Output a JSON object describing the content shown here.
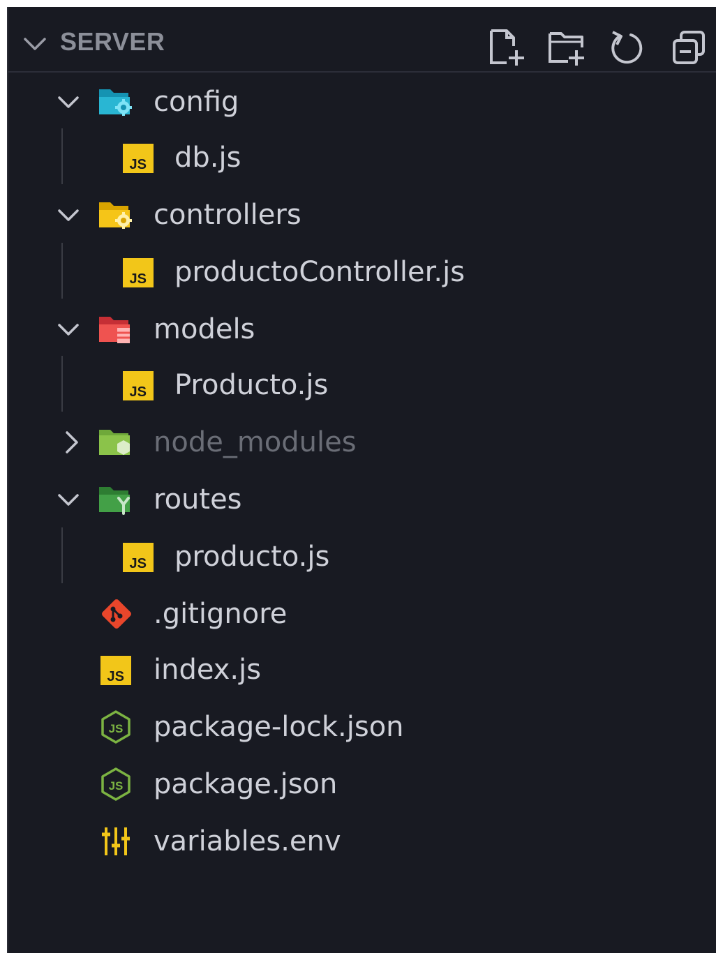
{
  "header": {
    "title": "SERVER",
    "icons": [
      "new-file-icon",
      "new-folder-icon",
      "refresh-icon",
      "collapse-all-icon"
    ]
  },
  "tree": [
    {
      "name": "config",
      "type": "folder",
      "expanded": true,
      "depth": 0,
      "icon": "folder-config-icon",
      "color": "#1fa6c3"
    },
    {
      "name": "db.js",
      "type": "file",
      "depth": 1,
      "icon": "js-file-icon",
      "color": "#f2c619"
    },
    {
      "name": "controllers",
      "type": "folder",
      "expanded": true,
      "depth": 0,
      "icon": "folder-controllers-icon",
      "color": "#f2c619"
    },
    {
      "name": "productoController.js",
      "type": "file",
      "depth": 1,
      "icon": "js-file-icon",
      "color": "#f2c619"
    },
    {
      "name": "models",
      "type": "folder",
      "expanded": true,
      "depth": 0,
      "icon": "folder-models-icon",
      "color": "#e5484d"
    },
    {
      "name": "Producto.js",
      "type": "file",
      "depth": 1,
      "icon": "js-file-icon",
      "color": "#f2c619"
    },
    {
      "name": "node_modules",
      "type": "folder",
      "expanded": false,
      "depth": 0,
      "dimmed": true,
      "icon": "folder-node-icon",
      "color": "#8bc34a"
    },
    {
      "name": "routes",
      "type": "folder",
      "expanded": true,
      "depth": 0,
      "icon": "folder-routes-icon",
      "color": "#43a047"
    },
    {
      "name": "producto.js",
      "type": "file",
      "depth": 1,
      "icon": "js-file-icon",
      "color": "#f2c619"
    },
    {
      "name": ".gitignore",
      "type": "file",
      "depth": 0,
      "icon": "git-icon",
      "color": "#e8462b"
    },
    {
      "name": "index.js",
      "type": "file",
      "depth": 0,
      "icon": "js-file-icon",
      "color": "#f2c619"
    },
    {
      "name": "package-lock.json",
      "type": "file",
      "depth": 0,
      "icon": "nodejs-icon",
      "color": "#7cb342"
    },
    {
      "name": "package.json",
      "type": "file",
      "depth": 0,
      "icon": "nodejs-icon",
      "color": "#7cb342"
    },
    {
      "name": "variables.env",
      "type": "file",
      "depth": 0,
      "icon": "env-icon",
      "color": "#f2c619"
    }
  ]
}
